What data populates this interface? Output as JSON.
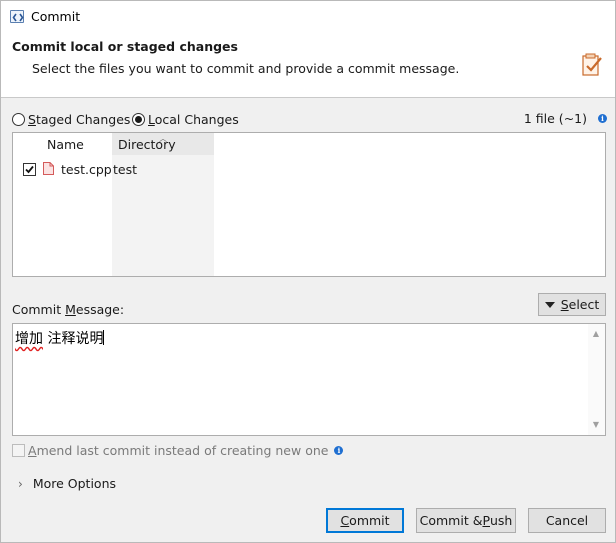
{
  "window": {
    "title": "Commit"
  },
  "banner": {
    "title": "Commit local or staged changes",
    "subtitle": "Select the files you want to commit and provide a commit message."
  },
  "changes": {
    "staged_label": "Staged Changes",
    "staged_mnemonic": "S",
    "staged_rest": "taged Changes",
    "local_label": "Local Changes",
    "local_mnemonic": "L",
    "local_rest": "ocal Changes",
    "selected": "local",
    "file_count": "1 file (~1)"
  },
  "table": {
    "columns": [
      "Name",
      "Directory"
    ],
    "rows": [
      {
        "checked": true,
        "name": "test.cpp",
        "directory": "test"
      }
    ]
  },
  "message": {
    "label_pre": "Commit ",
    "label_mnemonic": "M",
    "label_post": "essage:",
    "value_part1": "增加",
    "value_part2": " 注释说明",
    "select_mnemonic": "S",
    "select_rest": "elect"
  },
  "amend": {
    "label_mnemonic": "A",
    "label_rest": "mend last commit instead of creating new one",
    "checked": false,
    "enabled": false
  },
  "more_options": {
    "label": "More Options"
  },
  "buttons": {
    "commit_mnemonic": "C",
    "commit_rest": "ommit",
    "push_pre": "Commit & ",
    "push_mnemonic": "P",
    "push_rest": "ush",
    "cancel": "Cancel"
  },
  "icons": {
    "title": "code-brackets-icon",
    "banner": "commit-clipboard-icon",
    "info": "info-icon",
    "file": "cpp-file-icon"
  },
  "colors": {
    "accent": "#0078d7",
    "info": "#1f6fd1",
    "spellcheck": "#e02020"
  }
}
